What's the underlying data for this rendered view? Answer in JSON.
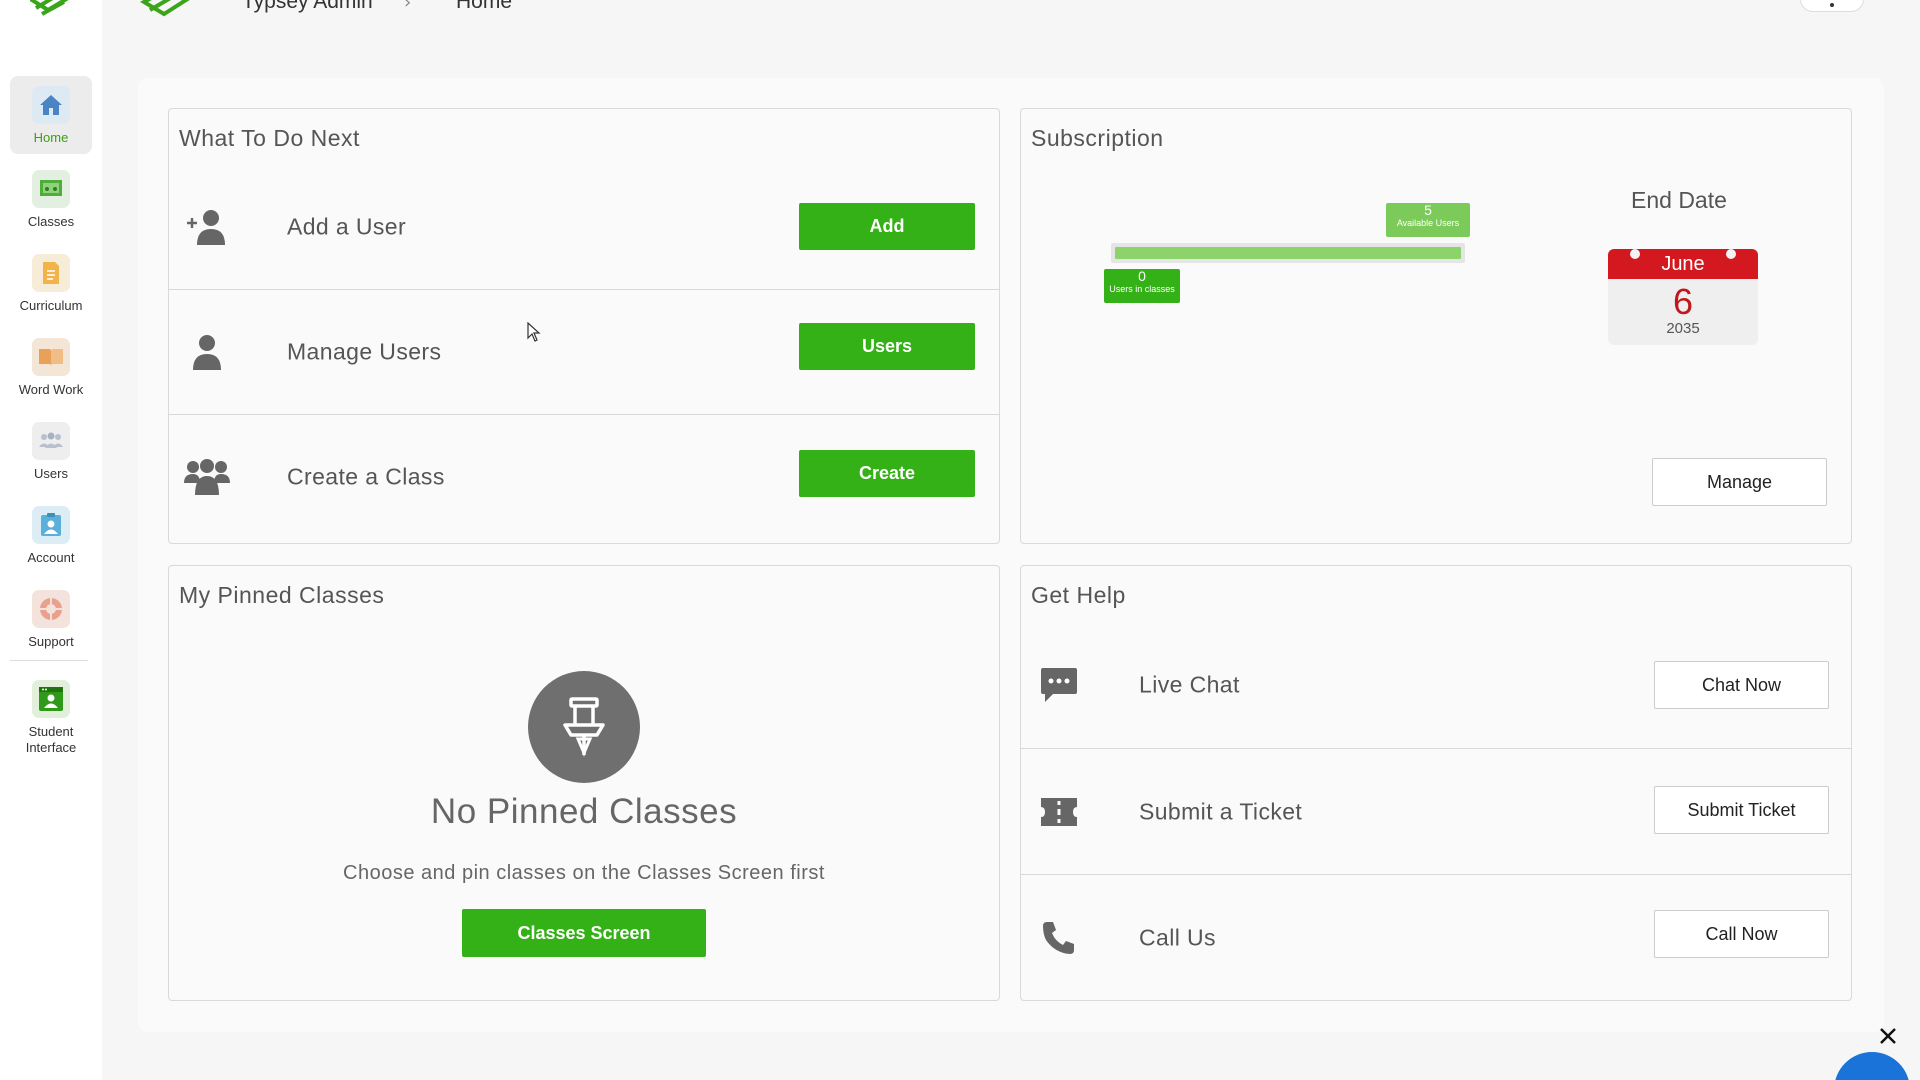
{
  "header": {
    "breadcrumb": [
      "Typsey Admin",
      "Home"
    ],
    "separator": "›"
  },
  "sidebar": {
    "items": [
      {
        "label": "Home",
        "icon": "home-icon",
        "active": true
      },
      {
        "label": "Classes",
        "icon": "classes-icon"
      },
      {
        "label": "Curriculum",
        "icon": "curriculum-icon"
      },
      {
        "label": "Word Work",
        "icon": "word-work-icon"
      },
      {
        "label": "Users",
        "icon": "users-icon"
      },
      {
        "label": "Account",
        "icon": "account-icon"
      },
      {
        "label": "Support",
        "icon": "support-icon"
      },
      {
        "label": "Student Interface",
        "icon": "student-interface-icon"
      }
    ]
  },
  "todo": {
    "title": "What To Do Next",
    "rows": [
      {
        "label": "Add a User",
        "button": "Add",
        "icon": "add-user-icon"
      },
      {
        "label": "Manage Users",
        "button": "Users",
        "icon": "user-icon"
      },
      {
        "label": "Create a Class",
        "button": "Create",
        "icon": "group-icon"
      }
    ]
  },
  "subscription": {
    "title": "Subscription",
    "available_users": 5,
    "available_label": "Available Users",
    "users_in_classes": 0,
    "users_in_classes_label": "Users in classes",
    "end_date_label": "End Date",
    "end_month": "June",
    "end_day": "6",
    "end_year": "2035",
    "manage_button": "Manage"
  },
  "pinned": {
    "title": "My Pinned Classes",
    "empty_title": "No Pinned Classes",
    "empty_desc": "Choose and pin classes on the Classes Screen first",
    "button": "Classes Screen"
  },
  "help": {
    "title": "Get Help",
    "rows": [
      {
        "label": "Live Chat",
        "button": "Chat Now",
        "icon": "chat-icon"
      },
      {
        "label": "Submit a Ticket",
        "button": "Submit Ticket",
        "icon": "ticket-icon"
      },
      {
        "label": "Call Us",
        "button": "Call Now",
        "icon": "phone-icon"
      }
    ]
  },
  "colors": {
    "brand_green": "#34b116",
    "calendar_red": "#d3181f",
    "chat_blue": "#1a73d9"
  }
}
